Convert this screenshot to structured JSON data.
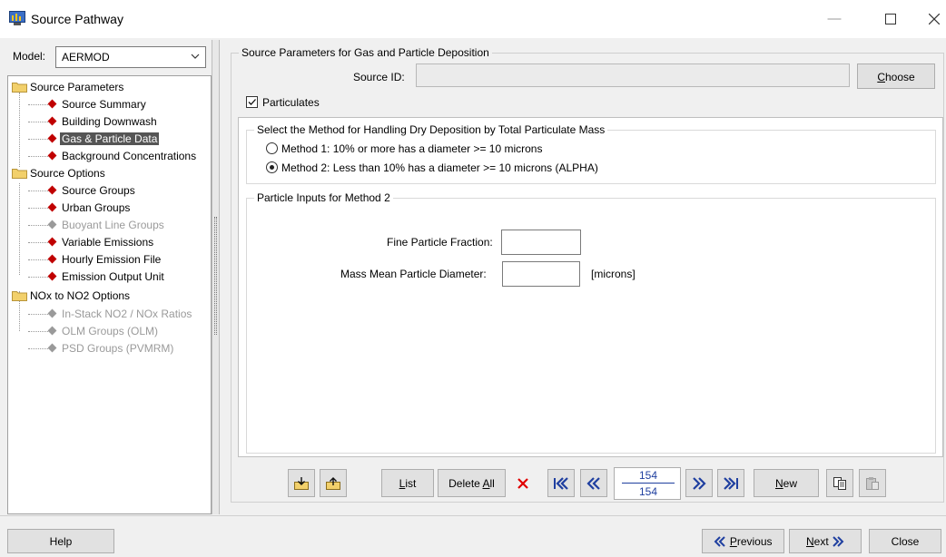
{
  "window": {
    "title": "Source Pathway"
  },
  "model": {
    "label": "Model:",
    "value": "AERMOD"
  },
  "tree": {
    "source_parameters": {
      "label": "Source Parameters",
      "items": [
        "Source Summary",
        "Building Downwash",
        "Gas & Particle Data",
        "Background Concentrations"
      ]
    },
    "source_options": {
      "label": "Source Options",
      "items": [
        "Source Groups",
        "Urban Groups",
        "Buoyant Line Groups",
        "Variable Emissions",
        "Hourly Emission File",
        "Emission Output Unit"
      ]
    },
    "nox_options": {
      "label": "NOx to NO2 Options",
      "items": [
        "In-Stack NO2 / NOx Ratios",
        "OLM Groups (OLM)",
        "PSD Groups (PVMRM)"
      ]
    }
  },
  "source_params": {
    "group_title": "Source Parameters for Gas and Particle Deposition",
    "source_id_label": "Source ID:",
    "source_id_value": "",
    "choose_rest": "hoose",
    "choose_key": "C",
    "particulates_label": "Particulates",
    "particulates_checked": true
  },
  "method": {
    "group_title": "Select the Method for Handling Dry Deposition by Total Particulate Mass",
    "option1": "Method 1: 10% or more has a diameter >= 10 microns",
    "option2": "Method 2: Less than 10% has a diameter >= 10 microns (ALPHA)",
    "selected": 2
  },
  "particle_inputs": {
    "group_title": "Particle Inputs for Method 2",
    "fine_label": "Fine Particle Fraction:",
    "fine_value": "",
    "mmpd_label": "Mass Mean Particle Diameter:",
    "mmpd_value": "",
    "units": "[microns]"
  },
  "toolbar": {
    "list_key": "L",
    "list_rest": "ist",
    "delete_all_pre": "Delete ",
    "delete_all_key": "A",
    "delete_all_rest": "ll",
    "new_key": "N",
    "new_rest": "ew",
    "record_current": "154",
    "record_total": "154"
  },
  "bottom": {
    "help": "Help",
    "previous_key": "P",
    "previous_rest": "revious",
    "next_key": "N",
    "next_rest": "ext",
    "close": "Close"
  },
  "icons": {
    "close_x_color": "#e00000",
    "nav_arrow_color": "#1f3fa0",
    "tree_bullet_color": "#c00000"
  }
}
